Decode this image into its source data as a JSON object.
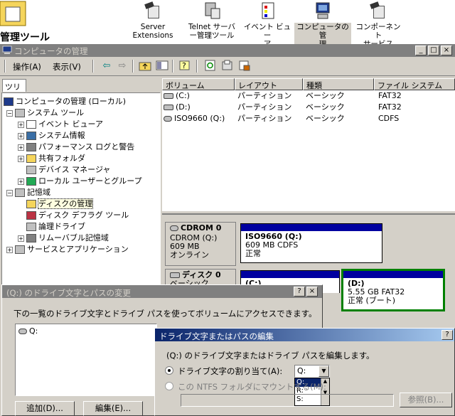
{
  "shortcuts": [
    {
      "id": "server-extensions",
      "label": "Server\nExtensions ...",
      "icon": "tool-icon"
    },
    {
      "id": "telnet",
      "label": "Telnet サーバ\nー管理ツール",
      "icon": "telnet-server-icon"
    },
    {
      "id": "event-viewer",
      "label": "イベント ビュー\nア",
      "icon": "event-viewer-icon"
    },
    {
      "id": "computer-management",
      "label": "コンピュータの管\n理",
      "icon": "computer-management-icon",
      "selected": true
    },
    {
      "id": "component-services",
      "label": "コンポーネント\nサービス",
      "icon": "component-services-icon"
    }
  ],
  "folder_title": "管理ツール",
  "window": {
    "title": "コンピュータの管理",
    "buttons": [
      "_",
      "□",
      "×"
    ]
  },
  "menu": {
    "action": "操作(A)",
    "view": "表示(V)"
  },
  "tree_tab": "ツリー",
  "tree": {
    "root": "コンピュータの管理 (ローカル)",
    "system_tools": "システム ツール",
    "event_viewer": "イベント ビューア",
    "system_info": "システム情報",
    "perf_logs": "パフォーマンス ログと警告",
    "shared_folders": "共有フォルダ",
    "device_manager": "デバイス マネージャ",
    "local_users": "ローカル ユーザーとグループ",
    "storage": "記憶域",
    "disk_management": "ディスクの管理",
    "defrag": "ディスク デフラグ ツール",
    "logical_drives": "論理ドライブ",
    "removable": "リムーバブル記憶域",
    "services_apps": "サービスとアプリケーション"
  },
  "volume_columns": [
    "ボリューム",
    "レイアウト",
    "種類",
    "ファイル システム"
  ],
  "volumes": [
    {
      "volume": "(C:)",
      "layout": "パーティション",
      "type": "ベーシック",
      "fs": "FAT32"
    },
    {
      "volume": "(D:)",
      "layout": "パーティション",
      "type": "ベーシック",
      "fs": "FAT32"
    },
    {
      "volume": "ISO9660 (Q:)",
      "layout": "パーティション",
      "type": "ベーシック",
      "fs": "CDFS"
    }
  ],
  "disks": {
    "cdrom": {
      "name": "CDROM 0",
      "line1": "CDROM (Q:)",
      "size": "609 MB",
      "status": "オンライン"
    },
    "cdrom_part": {
      "title": "ISO9660 (Q:)",
      "detail": "609 MB CDFS",
      "status": "正常"
    },
    "disk0": {
      "name": "ディスク 0",
      "sub": "ベーシック"
    },
    "disk0_part1": {
      "title": "(C:)"
    },
    "disk0_part2": {
      "title": "(D:)",
      "detail": "5.55 GB FAT32",
      "status": "正常 (ブート)"
    }
  },
  "colors": {
    "partition_bar": "#0000a0",
    "selection_border": "#008000",
    "active_caption": "#0a246a"
  },
  "dialog1": {
    "title": "(Q:) のドライブ文字とパスの変更",
    "description": "下の一覧のドライブ文字とドライブ パスを使ってボリュームにアクセスできます。",
    "list_item": "Q:",
    "add_button": "追加(D)...",
    "edit_button": "編集(E)..."
  },
  "dialog2": {
    "title": "ドライブ文字またはパスの編集",
    "description": "(Q:) のドライブ文字またはドライブ パスを編集します。",
    "assign_label": "ドライブ文字の割り当て(A):",
    "mount_label": "この NTFS フォルダにマウントする(M):",
    "selected_letter": "Q:",
    "letter_options": [
      "Q:",
      "R:",
      "S:"
    ],
    "browse_button": "参照(B)..."
  }
}
